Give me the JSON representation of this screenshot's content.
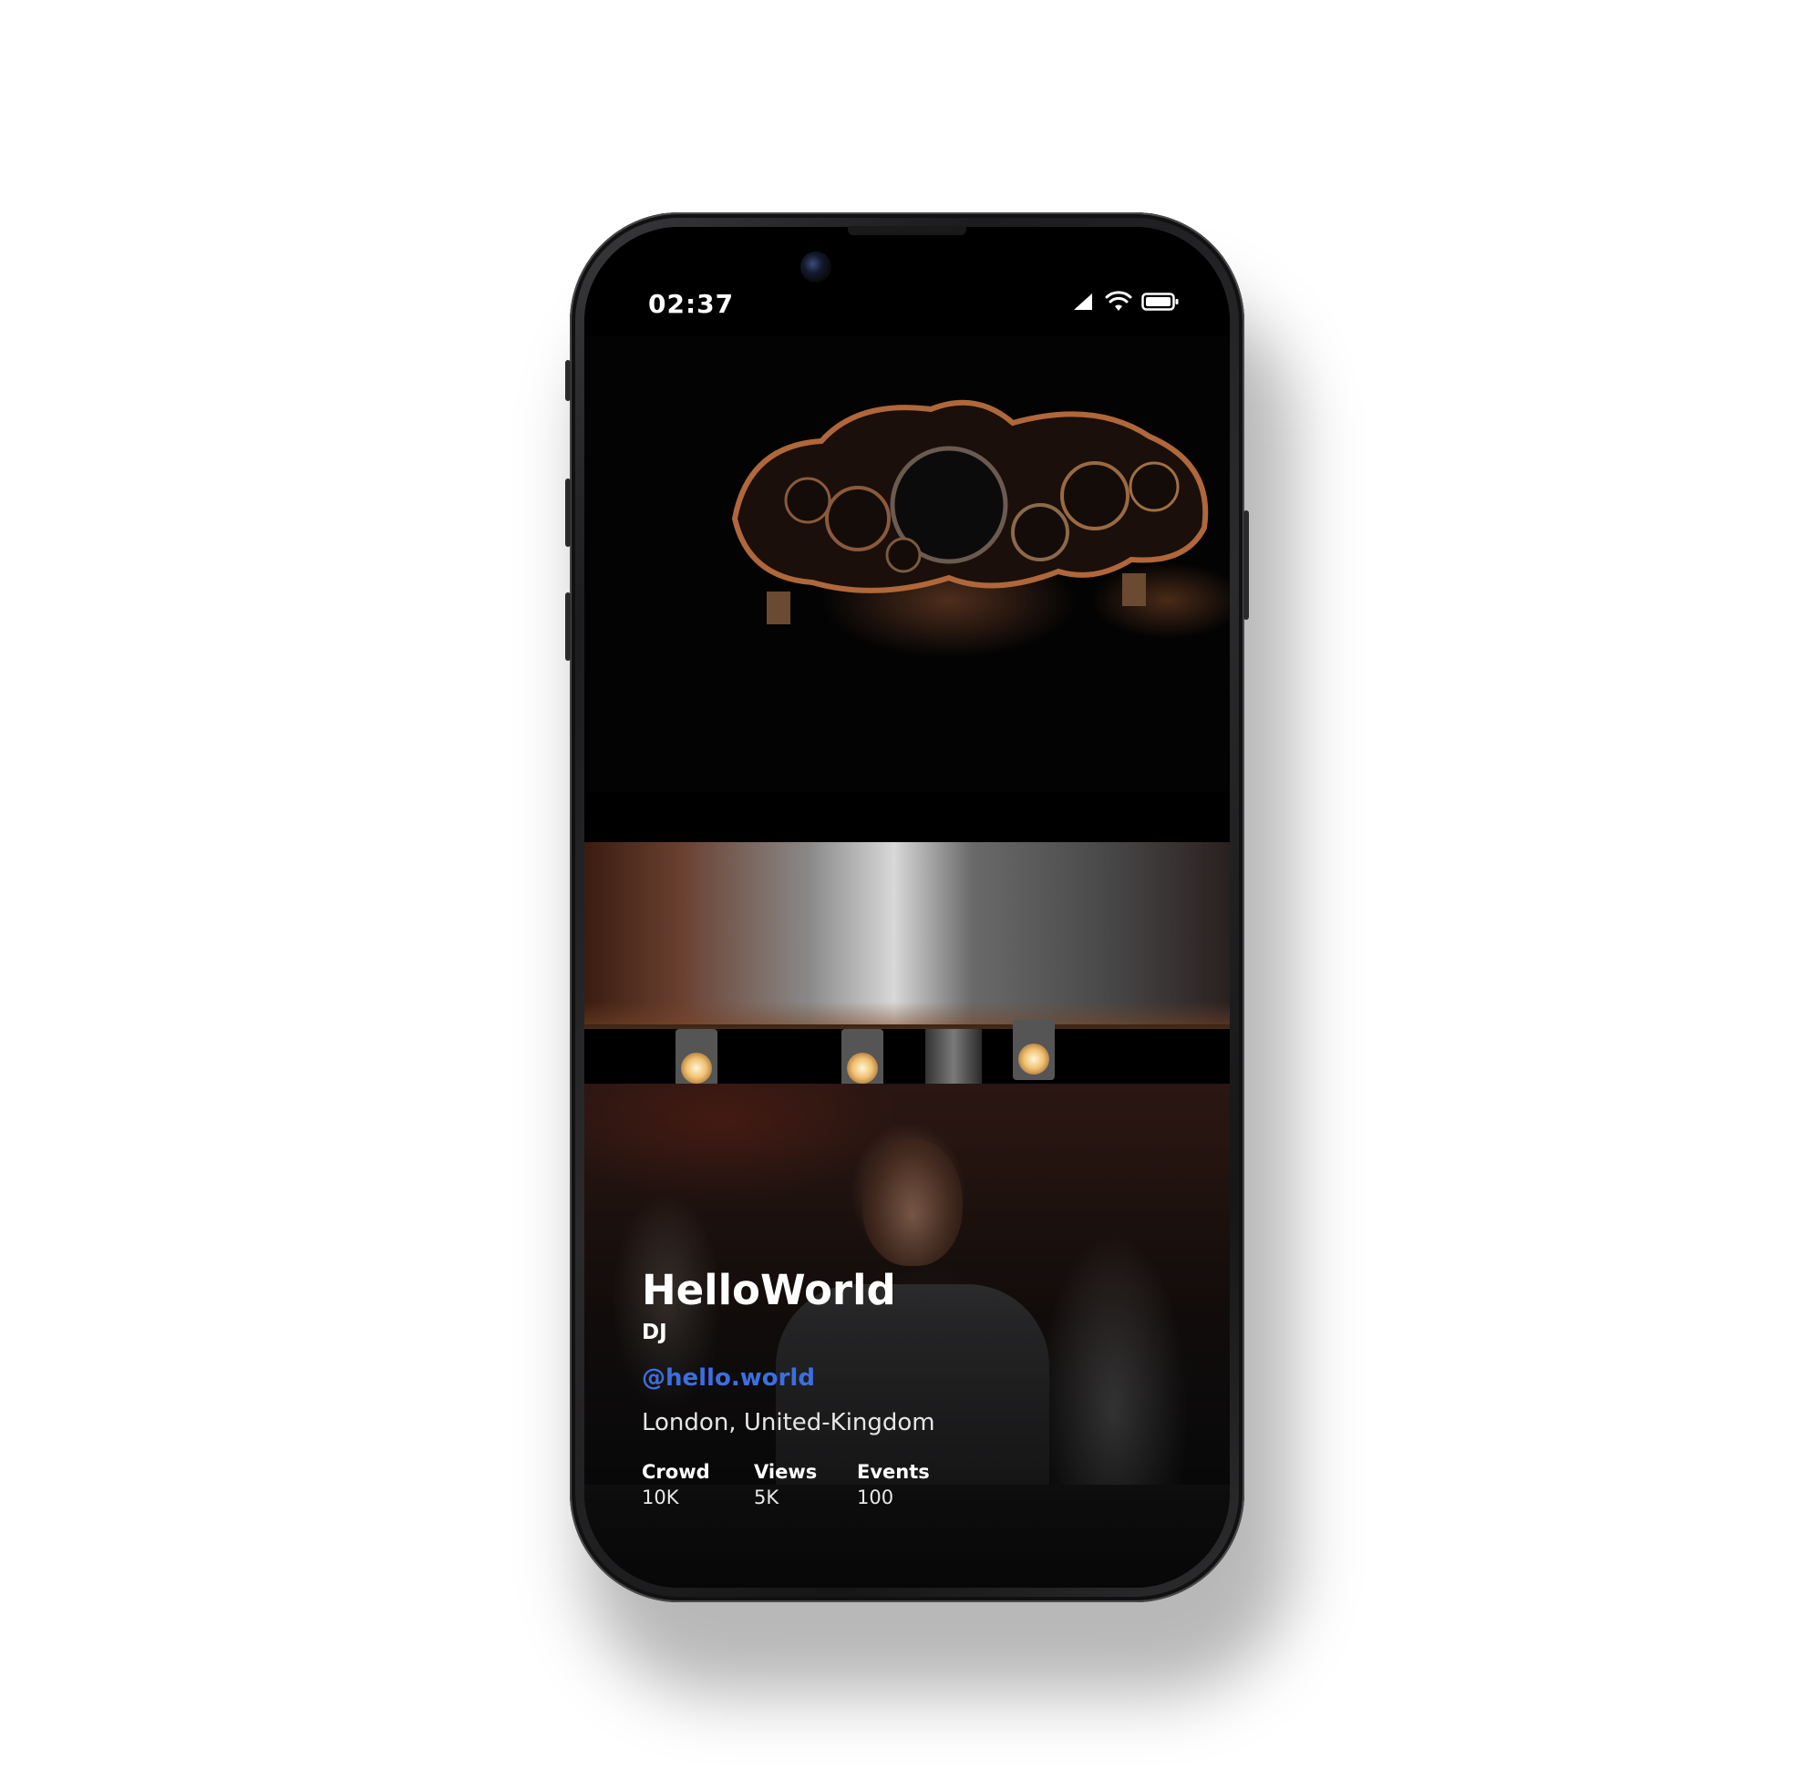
{
  "status_bar": {
    "time": "02:37",
    "icons": [
      "signal-icon",
      "wifi-icon",
      "battery-icon"
    ]
  },
  "profile": {
    "name": "HelloWorld",
    "role": "DJ",
    "handle": "@hello.world",
    "location": "London, United-Kingdom",
    "stats": [
      {
        "label": "Crowd",
        "value": "10K"
      },
      {
        "label": "Views",
        "value": "5K"
      },
      {
        "label": "Events",
        "value": "100"
      }
    ]
  },
  "colors": {
    "handle_link": "#3b6fe0",
    "text_primary": "#ffffff",
    "background": "#000000"
  }
}
